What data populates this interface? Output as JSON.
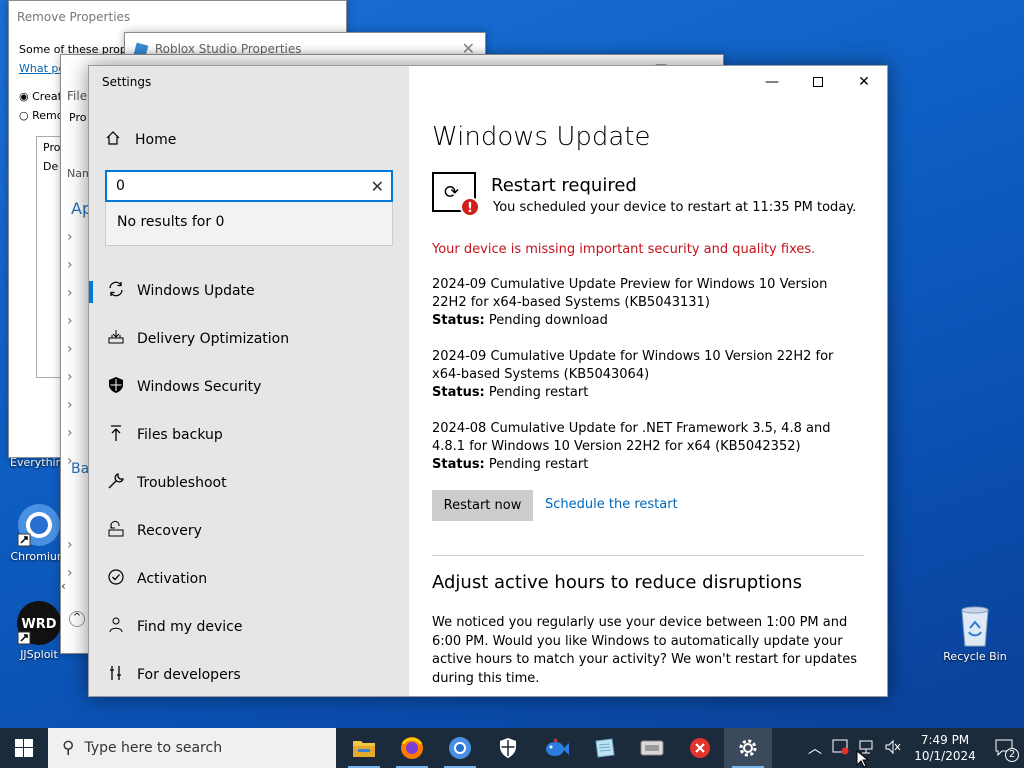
{
  "desktop": {
    "icons": [
      {
        "label": "Chromium",
        "icon": "chromium-icon"
      },
      {
        "label": "JJSploit",
        "icon": "jjsploit-icon"
      },
      {
        "label": "Recycle Bin",
        "icon": "recycle-bin-icon"
      }
    ],
    "partial_label_everything": "Everythin"
  },
  "bg_windows": {
    "remove_props": {
      "title": "Remove Properties",
      "line1": "Some of these proper",
      "link": "What pe",
      "radio1": "Creat",
      "radio2": "Remo",
      "tab": "Prop",
      "row": "De"
    },
    "roblox_props": {
      "title": "Roblox Studio Properties"
    },
    "explorer": {
      "file": "File",
      "pro": "Pro",
      "nam": "Nam",
      "ap": "Ap",
      "ba": "Ba"
    }
  },
  "settings": {
    "window_title": "Settings",
    "home_label": "Home",
    "search": {
      "value": "0",
      "no_results": "No results for 0"
    },
    "nav": [
      {
        "label": "Windows Update",
        "icon": "sync-icon",
        "active": true
      },
      {
        "label": "Delivery Optimization",
        "icon": "delivery-icon"
      },
      {
        "label": "Windows Security",
        "icon": "shield-icon"
      },
      {
        "label": "Files backup",
        "icon": "backup-arrow-icon"
      },
      {
        "label": "Troubleshoot",
        "icon": "wrench-icon"
      },
      {
        "label": "Recovery",
        "icon": "recovery-icon"
      },
      {
        "label": "Activation",
        "icon": "check-circle-icon"
      },
      {
        "label": "Find my device",
        "icon": "person-locate-icon"
      },
      {
        "label": "For developers",
        "icon": "developer-icon"
      }
    ],
    "content": {
      "title": "Windows Update",
      "restart_title": "Restart required",
      "restart_sub": "You scheduled your device to restart at 11:35 PM today.",
      "warning": "Your device is missing important security and quality fixes.",
      "status_label": "Status:",
      "updates": [
        {
          "name": "2024-09 Cumulative Update Preview for Windows 10 Version 22H2 for x64-based Systems (KB5043131)",
          "status": "Pending download"
        },
        {
          "name": "2024-09 Cumulative Update for Windows 10 Version 22H2 for x64-based Systems (KB5043064)",
          "status": "Pending restart"
        },
        {
          "name": "2024-08 Cumulative Update for .NET Framework 3.5, 4.8 and 4.8.1 for Windows 10 Version 22H2 for x64 (KB5042352)",
          "status": "Pending restart"
        }
      ],
      "restart_now": "Restart now",
      "schedule": "Schedule the restart",
      "active_hours_title": "Adjust active hours to reduce disruptions",
      "active_hours_text": "We noticed you regularly use your device between 1:00 PM and 6:00 PM. Would you like Windows to automatically update your active hours to match your activity? We won't restart for updates during this time."
    }
  },
  "taskbar": {
    "search_placeholder": "Type here to search",
    "apps": [
      "file-explorer-icon",
      "firefox-icon",
      "chromium-icon",
      "security-shield-icon",
      "fish-app-icon",
      "notepad-app-icon",
      "drive-app-icon",
      "red-x-app-icon",
      "settings-gear-icon"
    ],
    "time": "7:49 PM",
    "date": "10/1/2024",
    "notification_count": "2"
  },
  "colors": {
    "accent": "#0078d7",
    "warning": "#c5131b",
    "link": "#0067b8",
    "taskbar": "#1c2b3c"
  }
}
